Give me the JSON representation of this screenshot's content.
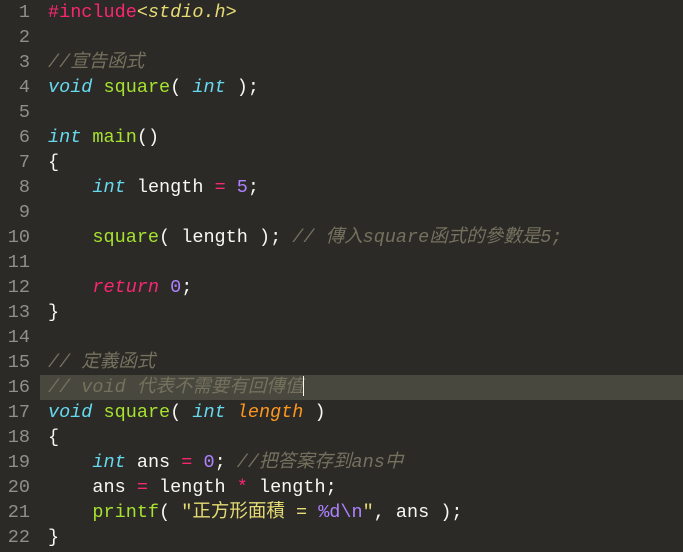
{
  "lines": {
    "1": {
      "num": "1",
      "t1": "#include",
      "t2": "<stdio.h>"
    },
    "2": {
      "num": "2"
    },
    "3": {
      "num": "3",
      "t1": "//宣告函式"
    },
    "4": {
      "num": "4",
      "t1": "void",
      "t2": "square",
      "t3": "( ",
      "t4": "int",
      "t5": " );"
    },
    "5": {
      "num": "5"
    },
    "6": {
      "num": "6",
      "t1": "int",
      "t2": "main",
      "t3": "()"
    },
    "7": {
      "num": "7",
      "t1": "{"
    },
    "8": {
      "num": "8",
      "t1": "    ",
      "t2": "int",
      "t3": " length ",
      "t4": "=",
      "t5": " ",
      "t6": "5",
      "t7": ";"
    },
    "9": {
      "num": "9"
    },
    "10": {
      "num": "10",
      "t1": "    ",
      "t2": "square",
      "t3": "( length ); ",
      "t4": "// 傳入square函式的參數是5;"
    },
    "11": {
      "num": "11"
    },
    "12": {
      "num": "12",
      "t1": "    ",
      "t2": "return",
      "t3": " ",
      "t4": "0",
      "t5": ";"
    },
    "13": {
      "num": "13",
      "t1": "}"
    },
    "14": {
      "num": "14"
    },
    "15": {
      "num": "15",
      "t1": "// 定義函式"
    },
    "16": {
      "num": "16",
      "t1": "// void 代表不需要有回傳值"
    },
    "17": {
      "num": "17",
      "t1": "void",
      "t2": "square",
      "t3": "( ",
      "t4": "int",
      "t5": " ",
      "t6": "length",
      "t7": " )"
    },
    "18": {
      "num": "18",
      "t1": "{"
    },
    "19": {
      "num": "19",
      "t1": "    ",
      "t2": "int",
      "t3": " ans ",
      "t4": "=",
      "t5": " ",
      "t6": "0",
      "t7": "; ",
      "t8": "//把答案存到ans中"
    },
    "20": {
      "num": "20",
      "t1": "    ans ",
      "t2": "=",
      "t3": " length ",
      "t4": "*",
      "t5": " length;"
    },
    "21": {
      "num": "21",
      "t1": "    ",
      "t2": "printf",
      "t3": "( ",
      "t4": "\"正方形面積 = ",
      "t5": "%d\\n",
      "t6": "\"",
      "t7": ", ans );"
    },
    "22": {
      "num": "22",
      "t1": "}"
    }
  }
}
